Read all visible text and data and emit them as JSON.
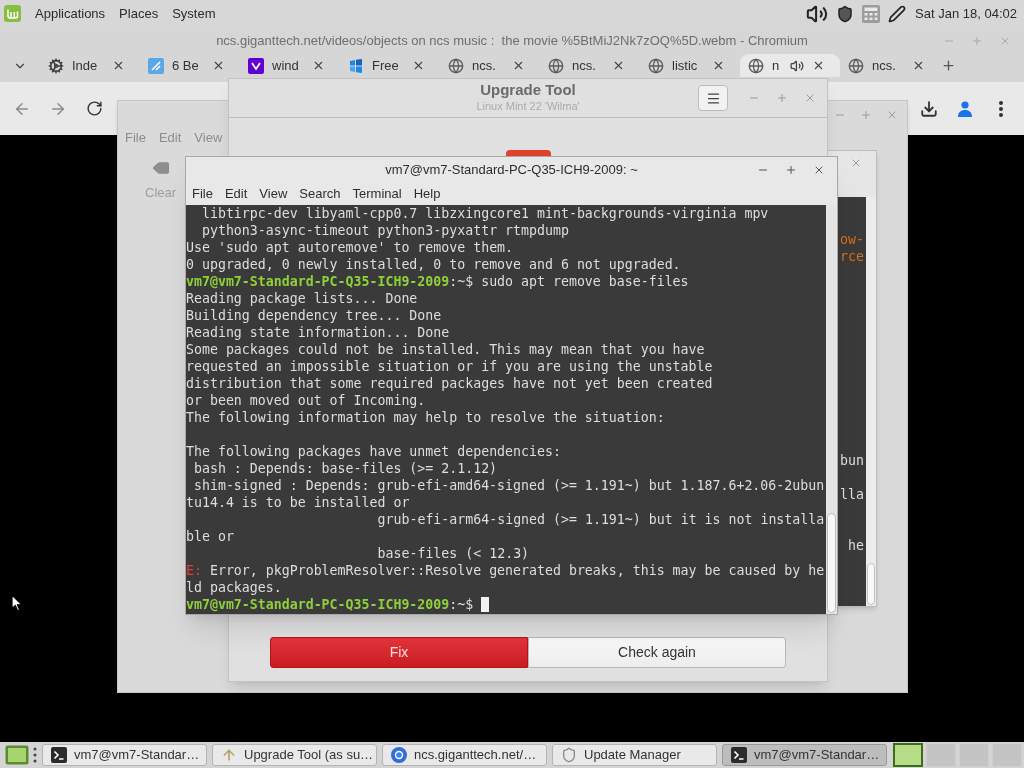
{
  "top_panel": {
    "menus": [
      "Applications",
      "Places",
      "System"
    ],
    "clock": "Sat Jan 18, 04:02"
  },
  "browser": {
    "title": "ncs.giganttech.net/videos/objects on ncs music :  the movie %5BtMiJ2Nk7zOQ%5D.webm - Chromium",
    "tabs": [
      {
        "label": "Inde",
        "kind": "gear",
        "audio": false,
        "selected": false
      },
      {
        "label": "6 Be",
        "kind": "tile",
        "audio": false,
        "selected": false
      },
      {
        "label": "wind",
        "kind": "chevron",
        "audio": false,
        "selected": false
      },
      {
        "label": "Free",
        "kind": "panes",
        "audio": false,
        "selected": false
      },
      {
        "label": "ncs.",
        "kind": "globe",
        "audio": false,
        "selected": false
      },
      {
        "label": "ncs.",
        "kind": "globe",
        "audio": false,
        "selected": false
      },
      {
        "label": "listic",
        "kind": "globe",
        "audio": false,
        "selected": false
      },
      {
        "label": "n",
        "kind": "globe",
        "audio": true,
        "selected": true
      },
      {
        "label": "ncs.",
        "kind": "globe",
        "audio": false,
        "selected": false
      }
    ]
  },
  "update_manager": {
    "menus": [
      "File",
      "Edit",
      "View"
    ],
    "toolbar": [
      {
        "label": "Clear",
        "disabled": true
      }
    ]
  },
  "background_terminal": {
    "lines": [
      {
        "kind": "blank"
      },
      {
        "kind": "blank"
      },
      {
        "kind": "warning",
        "text": "ow-"
      },
      {
        "kind": "warning",
        "text": "rce"
      },
      {
        "kind": "blank"
      },
      {
        "kind": "blank"
      },
      {
        "kind": "blank"
      },
      {
        "kind": "blank"
      },
      {
        "kind": "blank"
      },
      {
        "kind": "blank"
      },
      {
        "kind": "blank"
      },
      {
        "kind": "blank"
      },
      {
        "kind": "blank"
      },
      {
        "kind": "blank"
      },
      {
        "kind": "blank"
      },
      {
        "kind": "text",
        "text": "bun"
      },
      {
        "kind": "blank"
      },
      {
        "kind": "text",
        "text": "lla"
      },
      {
        "kind": "blank"
      },
      {
        "kind": "blank"
      },
      {
        "kind": "text",
        "text": "he"
      }
    ]
  },
  "upgrade_tool": {
    "title": "Upgrade Tool",
    "subtitle": "Linux Mint 22 'Wilma'",
    "buttons": [
      {
        "label": "Fix",
        "kind": "destructive"
      },
      {
        "label": "Check again",
        "kind": "normal"
      }
    ]
  },
  "terminal": {
    "title": "vm7@vm7-Standard-PC-Q35-ICH9-2009: ~",
    "menus": [
      "File",
      "Edit",
      "View",
      "Search",
      "Terminal",
      "Help"
    ],
    "lines": [
      {
        "kind": "text",
        "text": "  libtirpc-dev libyaml-cpp0.7 libzxingcore1 mint-backgrounds-virginia mpv"
      },
      {
        "kind": "text",
        "text": "  python3-async-timeout python3-pyxattr rtmpdump"
      },
      {
        "kind": "text",
        "text": "Use 'sudo apt autoremove' to remove them."
      },
      {
        "kind": "text",
        "text": "0 upgraded, 0 newly installed, 0 to remove and 6 not upgraded."
      },
      {
        "kind": "prompt",
        "user_host": "vm7@vm7-Standard-PC-Q35-ICH9-2009",
        "path": ":~$",
        "command": "sudo apt remove base-files",
        "cursor": false
      },
      {
        "kind": "text",
        "text": "Reading package lists... Done"
      },
      {
        "kind": "text",
        "text": "Building dependency tree... Done"
      },
      {
        "kind": "text",
        "text": "Reading state information... Done"
      },
      {
        "kind": "text",
        "text": "Some packages could not be installed. This may mean that you have"
      },
      {
        "kind": "text",
        "text": "requested an impossible situation or if you are using the unstable"
      },
      {
        "kind": "text",
        "text": "distribution that some required packages have not yet been created"
      },
      {
        "kind": "text",
        "text": "or been moved out of Incoming."
      },
      {
        "kind": "text",
        "text": "The following information may help to resolve the situation:"
      },
      {
        "kind": "blank"
      },
      {
        "kind": "text",
        "text": "The following packages have unmet dependencies:"
      },
      {
        "kind": "text",
        "text": " bash : Depends: base-files (>= 2.1.12)"
      },
      {
        "kind": "text",
        "text": " shim-signed : Depends: grub-efi-amd64-signed (>= 1.191~) but 1.187.6+2.06-2ubun"
      },
      {
        "kind": "text",
        "text": "tu14.4 is to be installed or"
      },
      {
        "kind": "text",
        "text": "                        grub-efi-arm64-signed (>= 1.191~) but it is not installa"
      },
      {
        "kind": "text",
        "text": "ble or"
      },
      {
        "kind": "text",
        "text": "                        base-files (< 12.3)"
      },
      {
        "kind": "error",
        "tag": "E:",
        "text": "Error, pkgProblemResolver::Resolve generated breaks, this may be caused by he"
      },
      {
        "kind": "text",
        "text": "ld packages."
      },
      {
        "kind": "prompt",
        "user_host": "vm7@vm7-Standard-PC-Q35-ICH9-2009",
        "path": ":~$",
        "cursor": true
      }
    ]
  },
  "taskbar": {
    "items": [
      {
        "label": "vm7@vm7-Standar…",
        "kind": "terminal",
        "selected": false
      },
      {
        "label": "Upgrade Tool (as su…",
        "kind": "upgrade",
        "selected": false
      },
      {
        "label": "ncs.giganttech.net/…",
        "kind": "browser",
        "selected": false
      },
      {
        "label": "Update Manager",
        "kind": "shield",
        "selected": false
      },
      {
        "label": "vm7@vm7-Standar…",
        "kind": "terminal",
        "selected": true
      }
    ],
    "workspaces": [
      {
        "selected": true
      },
      {
        "selected": false
      },
      {
        "selected": false
      },
      {
        "selected": false
      }
    ]
  }
}
